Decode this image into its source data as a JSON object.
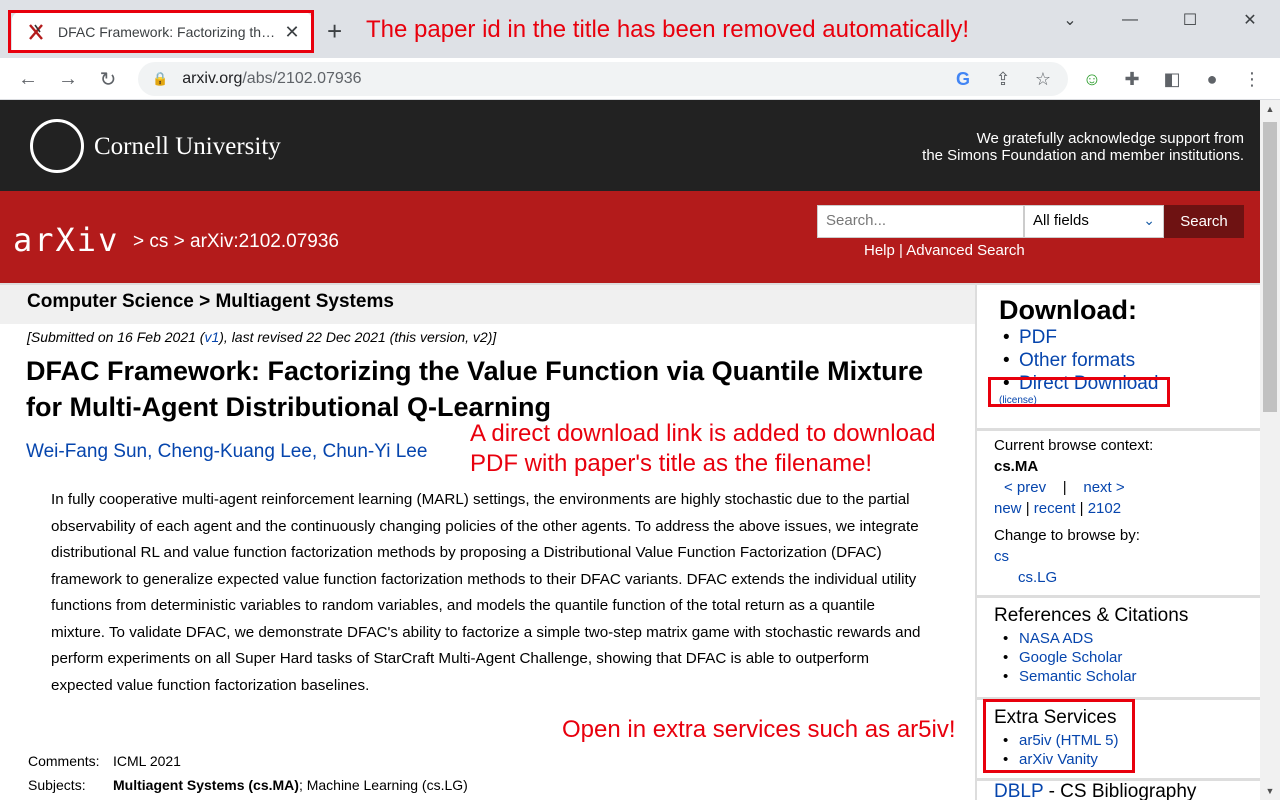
{
  "browser": {
    "tab_title": "DFAC Framework: Factorizing the Value Function via Quantile Mixture for Multi-Agent Distributional Q-Learning",
    "url_host": "arxiv.org",
    "url_path": "/abs/2102.07936"
  },
  "annotations": {
    "tab_note": "The paper id in the title has been removed automatically!",
    "download_note_line1": "A direct download link is added to download",
    "download_note_line2": "PDF with paper's title as the filename!",
    "extra_note": "Open in extra services such as ar5iv!",
    "color": "#e8000d"
  },
  "header": {
    "university": "Cornell University",
    "ack_line1": "We gratefully acknowledge support from",
    "ack_line2": "the Simons Foundation and member institutions."
  },
  "arxiv": {
    "logo": "arXiv",
    "crumbs": "> cs > arXiv:2102.07936",
    "search_placeholder": "Search...",
    "field_select": "All fields",
    "search_button": "Search",
    "help": "Help | Advanced Search"
  },
  "paper": {
    "subject_header": "Computer Science > Multiagent Systems",
    "submitted_prefix": "[Submitted on 16 Feb 2021 (",
    "submitted_v1": "v1",
    "submitted_suffix": "), last revised 22 Dec 2021 (this version, v2)]",
    "title": "DFAC Framework: Factorizing the Value Function via Quantile Mixture for Multi-Agent Distributional Q-Learning",
    "authors": [
      "Wei-Fang Sun",
      "Cheng-Kuang Lee",
      "Chun-Yi Lee"
    ],
    "abstract": "In fully cooperative multi-agent reinforcement learning (MARL) settings, the environments are highly stochastic due to the partial observability of each agent and the continuously changing policies of the other agents. To address the above issues, we integrate distributional RL and value function factorization methods by proposing a Distributional Value Function Factorization (DFAC) framework to generalize expected value function factorization methods to their DFAC variants. DFAC extends the individual utility functions from deterministic variables to random variables, and models the quantile function of the total return as a quantile mixture. To validate DFAC, we demonstrate DFAC's ability to factorize a simple two-step matrix game with stochastic rewards and perform experiments on all Super Hard tasks of StarCraft Multi-Agent Challenge, showing that DFAC is able to outperform expected value function factorization baselines.",
    "comments_label": "Comments:",
    "comments_value": "ICML 2021",
    "subjects_label": "Subjects:",
    "subjects_primary": "Multiagent Systems (cs.MA)",
    "subjects_rest": "; Machine Learning (cs.LG)"
  },
  "sidebar": {
    "download_title": "Download:",
    "download_links": [
      "PDF",
      "Other formats",
      "Direct Download"
    ],
    "license": "(license)",
    "context_label": "Current browse context:",
    "context_value": "cs.MA",
    "prev": "< prev",
    "sep": "|",
    "next": "next >",
    "new": "new",
    "recent": "recent",
    "yymm": "2102",
    "change_label": "Change to browse by:",
    "cs": "cs",
    "cslg": "cs.LG",
    "refs_title": "References & Citations",
    "refs_links": [
      "NASA ADS",
      "Google Scholar",
      "Semantic Scholar"
    ],
    "extra_title": "Extra Services",
    "extra_links": [
      "ar5iv (HTML 5)",
      "arXiv Vanity"
    ],
    "dblp_link": "DBLP",
    "dblp_rest": " - CS Bibliography"
  }
}
